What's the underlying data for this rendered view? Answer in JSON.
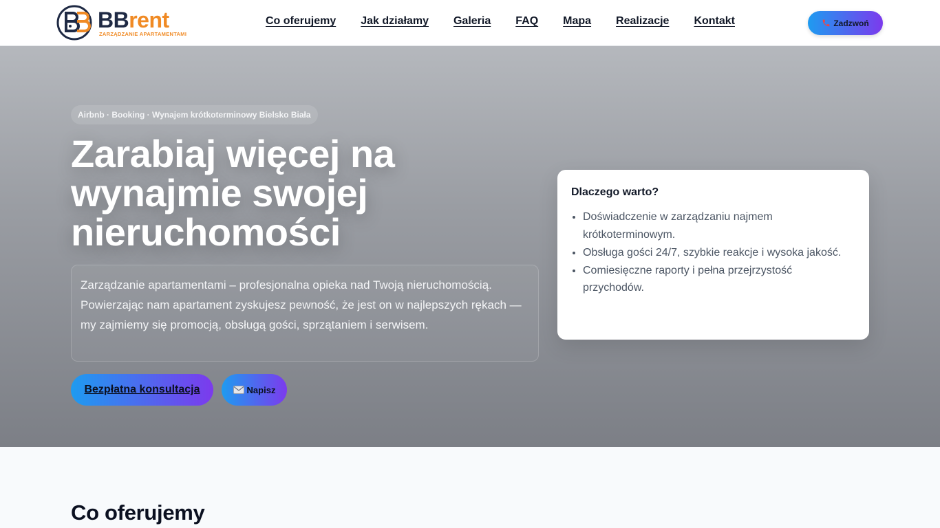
{
  "brand": {
    "word_bb": "BB",
    "word_rent": "rent",
    "subtitle": "ZARZĄDZANIE APARTAMENTAMI",
    "colors": {
      "navy": "#1f2a44",
      "orange": "#f08a24"
    }
  },
  "nav": {
    "items": [
      {
        "label": "Co oferujemy"
      },
      {
        "label": "Jak działamy"
      },
      {
        "label": "Galeria"
      },
      {
        "label": "FAQ"
      },
      {
        "label": "Mapa"
      },
      {
        "label": "Realizacje"
      },
      {
        "label": "Kontakt"
      }
    ],
    "call_icon": "phone-icon",
    "call_label": "Zadzwoń"
  },
  "hero": {
    "badge": "Airbnb · Booking · Wynajem krótkoterminowy Bielsko Biała",
    "headline": "Zarabiaj więcej na wynajmie swojej nieruchomości",
    "lead": "Zarządzanie apartamentami – profesjonalna opieka nad Twoją nieruchomością. Powierzając nam apartament zyskujesz pewność, że jest on w najlepszych rękach — my zajmiemy się promocją, obsługą gości, sprzątaniem i serwisem.",
    "primary_cta": "Bezpłatna konsultacja",
    "secondary_icon": "envelope-icon",
    "secondary_cta": "Napisz"
  },
  "why": {
    "title": "Dlaczego warto?",
    "items": [
      "Doświadczenie w zarządzaniu najmem krótkoterminowym.",
      "Obsługa gości 24/7, szybkie reakcje i wysoka jakość.",
      "Comiesięczne raporty i pełna przejrzystość przychodów."
    ]
  },
  "section": {
    "title": "Co oferujemy"
  },
  "colors": {
    "gradient_start": "#1e9bf0",
    "gradient_end": "#7c3aed"
  }
}
